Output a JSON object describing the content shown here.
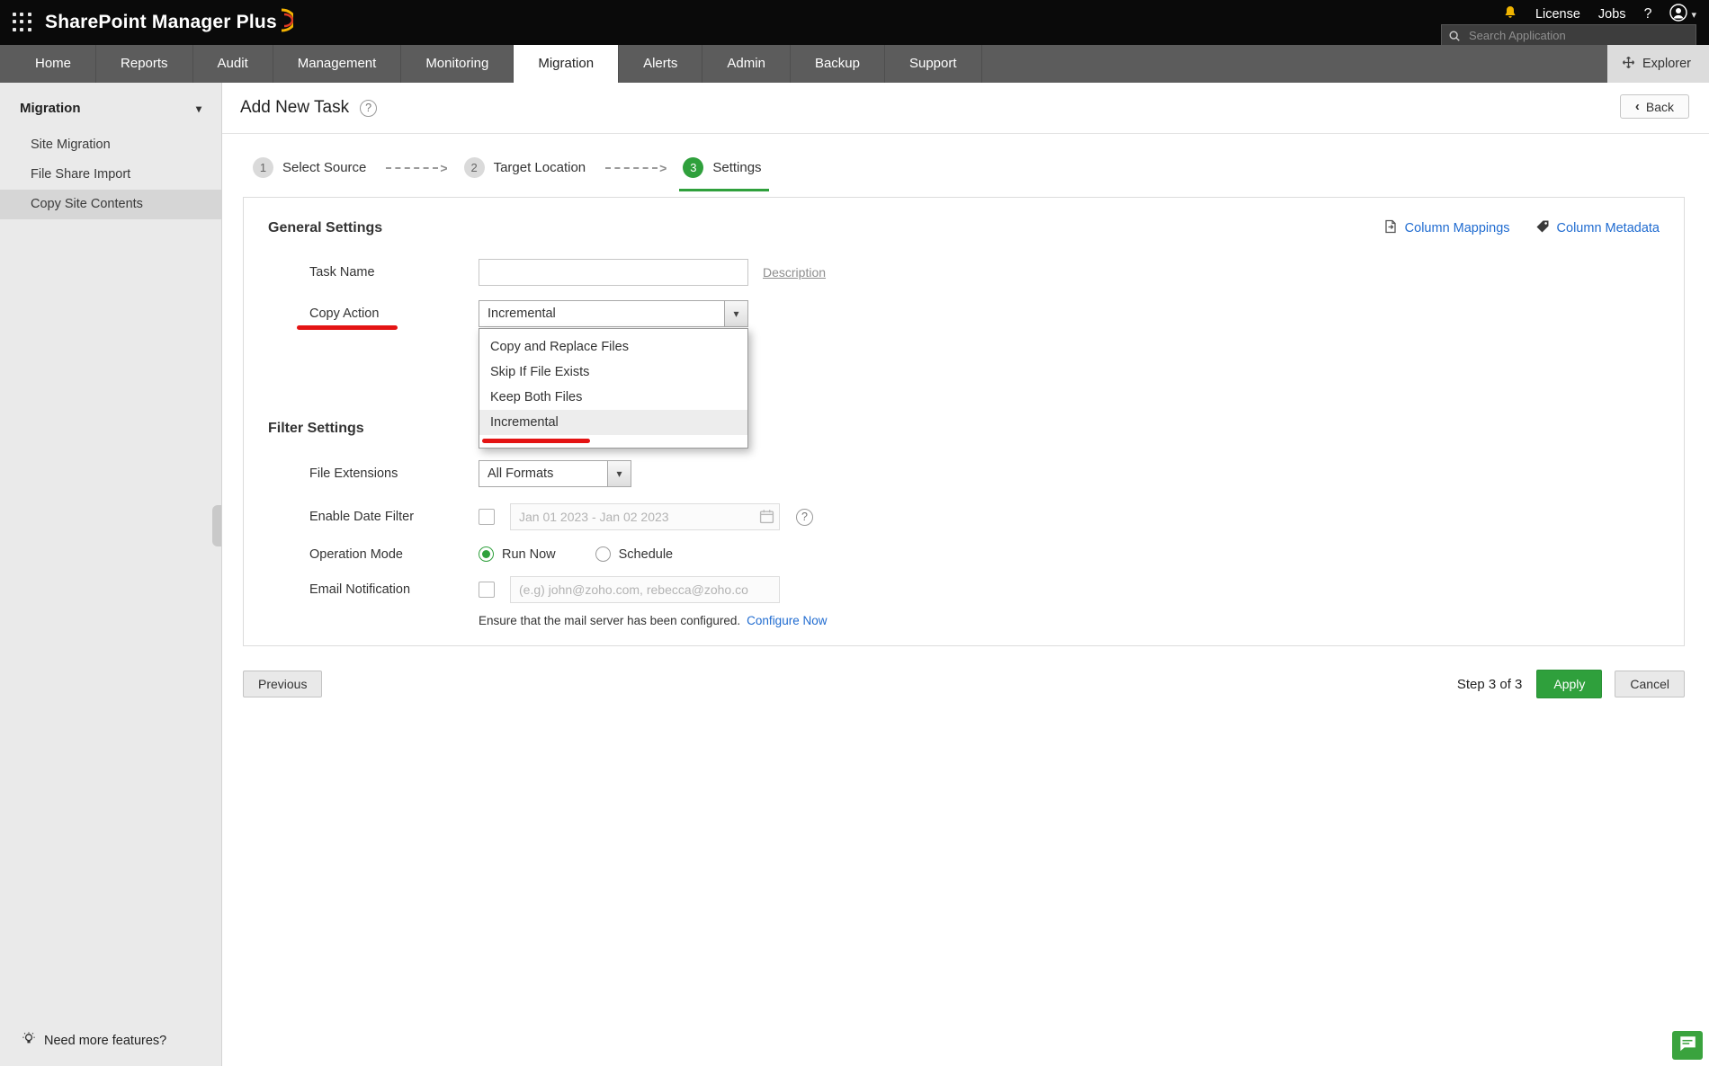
{
  "colors": {
    "accent_green": "#2fa03c",
    "link_blue": "#1f6bd0",
    "annotation_red": "#e41414",
    "topbar_bg": "#0a0a0a",
    "nav_bg": "#5c5c5c",
    "sidebar_bg": "#eaeaea"
  },
  "icons": {
    "caret_down": "▾",
    "chevron_left": "‹",
    "connector_arrow": ">",
    "help": "?"
  },
  "topbar": {
    "app_title": "SharePoint Manager Plus",
    "license_label": "License",
    "jobs_label": "Jobs",
    "search_placeholder": "Search Application"
  },
  "nav": {
    "tabs": [
      "Home",
      "Reports",
      "Audit",
      "Management",
      "Monitoring",
      "Migration",
      "Alerts",
      "Admin",
      "Backup",
      "Support"
    ],
    "active_tab": "Migration",
    "explorer_label": "Explorer"
  },
  "sidebar": {
    "title": "Migration",
    "items": [
      "Site Migration",
      "File Share Import",
      "Copy Site Contents"
    ],
    "active_item": "Copy Site Contents",
    "footer_label": "Need more features?"
  },
  "page": {
    "title": "Add New Task",
    "back_label": "Back",
    "steps": [
      {
        "num": "1",
        "label": "Select Source"
      },
      {
        "num": "2",
        "label": "Target Location"
      },
      {
        "num": "3",
        "label": "Settings"
      }
    ],
    "active_step": "Settings"
  },
  "form": {
    "general_heading": "General Settings",
    "column_mappings_label": "Column Mappings",
    "column_metadata_label": "Column Metadata",
    "task_name_label": "Task Name",
    "task_name_value": "",
    "description_label": "Description",
    "copy_action_label": "Copy Action",
    "copy_action_value": "Incremental",
    "copy_action_options": [
      "Copy and Replace Files",
      "Skip If File Exists",
      "Keep Both Files",
      "Incremental"
    ],
    "copy_action_selected": "Incremental",
    "filter_heading": "Filter Settings",
    "file_extensions_label": "File Extensions",
    "file_extensions_value": "All Formats",
    "date_filter_label": "Enable Date Filter",
    "date_filter_checked": false,
    "date_filter_value": "Jan 01 2023 - Jan 02 2023",
    "operation_mode_label": "Operation Mode",
    "operation_options": [
      "Run Now",
      "Schedule"
    ],
    "operation_selected": "Run Now",
    "email_label": "Email Notification",
    "email_checked": false,
    "email_placeholder": "(e.g) john@zoho.com, rebecca@zoho.co",
    "mail_note": "Ensure that the mail server has been configured.",
    "configure_now_label": "Configure Now"
  },
  "footer": {
    "previous_label": "Previous",
    "step_text": "Step 3 of 3",
    "apply_label": "Apply",
    "cancel_label": "Cancel"
  }
}
